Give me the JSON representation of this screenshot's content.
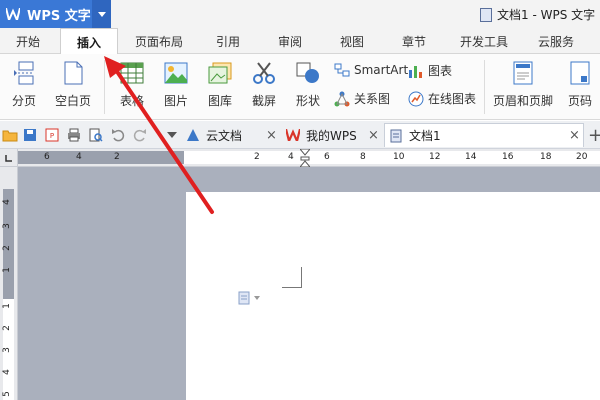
{
  "app": {
    "name": "WPS 文字",
    "window_title": "文档1 - WPS 文字"
  },
  "menu_tabs": [
    "开始",
    "插入",
    "页面布局",
    "引用",
    "审阅",
    "视图",
    "章节",
    "开发工具",
    "云服务"
  ],
  "active_tab": "插入",
  "ribbon": {
    "page_break": "分页",
    "blank_page": "空白页",
    "table": "表格",
    "picture": "图片",
    "gallery": "图库",
    "screenshot": "截屏",
    "shapes": "形状",
    "smartart": "SmartArt",
    "chart": "图表",
    "relation_chart": "关系图",
    "online_chart": "在线图表",
    "header_footer": "页眉和页脚",
    "page_number": "页码"
  },
  "doc_tabs": [
    {
      "label": "云文档",
      "active": false
    },
    {
      "label": "我的WPS",
      "active": false
    },
    {
      "label": "文档1",
      "active": true
    }
  ],
  "ruler": {
    "h_ticks": [
      "6",
      "4",
      "2",
      "2",
      "4",
      "6",
      "8",
      "10",
      "12",
      "14",
      "16",
      "18",
      "20"
    ],
    "v_ticks": [
      "4",
      "3",
      "2",
      "1",
      "1",
      "2",
      "3",
      "4",
      "5"
    ]
  },
  "colors": {
    "accent": "#3a78d6",
    "arrow": "#e02020",
    "canvas_bg": "#aab0bd"
  }
}
